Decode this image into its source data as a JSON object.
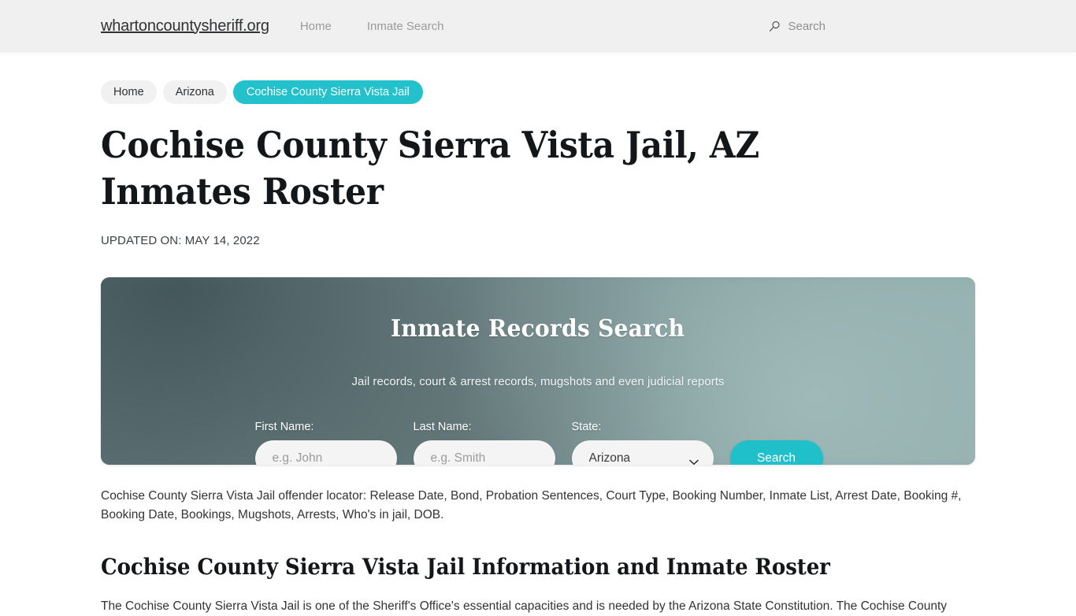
{
  "header": {
    "brand": "whartoncountysheriff.org",
    "nav": [
      {
        "label": "Home"
      },
      {
        "label": "Inmate Search"
      }
    ],
    "search_label": "Search",
    "search_icon": "search-icon"
  },
  "breadcrumbs": [
    {
      "label": "Home",
      "current": false
    },
    {
      "label": "Arizona",
      "current": false
    },
    {
      "label": "Cochise County Sierra Vista Jail",
      "current": true
    }
  ],
  "article": {
    "title": "Cochise County Sierra Vista Jail, AZ Inmates Roster",
    "updated_on": "UPDATED ON: MAY 14, 2022",
    "intro": "Cochise County Sierra Vista Jail offender locator: Release Date, Bond, Probation Sentences, Court Type, Booking Number, Inmate List, Arrest Date, Booking #, Booking Date, Bookings, Mugshots, Arrests, Who's in jail, DOB.",
    "section_heading": "Cochise County Sierra Vista Jail Information and Inmate Roster",
    "section_paragraph": "The Cochise County Sierra Vista Jail is one of the Sheriff's Office's essential capacities and is needed by the Arizona State Constitution. The Cochise County"
  },
  "search_panel": {
    "title": "Inmate Records Search",
    "subtitle": "Jail records, court & arrest records, mugshots and even judicial reports",
    "first_name": {
      "label": "First Name:",
      "placeholder": "e.g. John",
      "value": ""
    },
    "last_name": {
      "label": "Last Name:",
      "placeholder": "e.g. Smith",
      "value": ""
    },
    "state": {
      "label": "State:",
      "selected": "Arizona",
      "options": [
        "Arizona"
      ]
    },
    "submit_label": "Search",
    "chevron_icon": "chevron-down-icon"
  },
  "colors": {
    "accent_teal": "#20c0cb",
    "panel_background": "#6d8486",
    "header_background": "#f0f0f0",
    "crumb_background": "#f1f1f1",
    "text": "#333333"
  }
}
